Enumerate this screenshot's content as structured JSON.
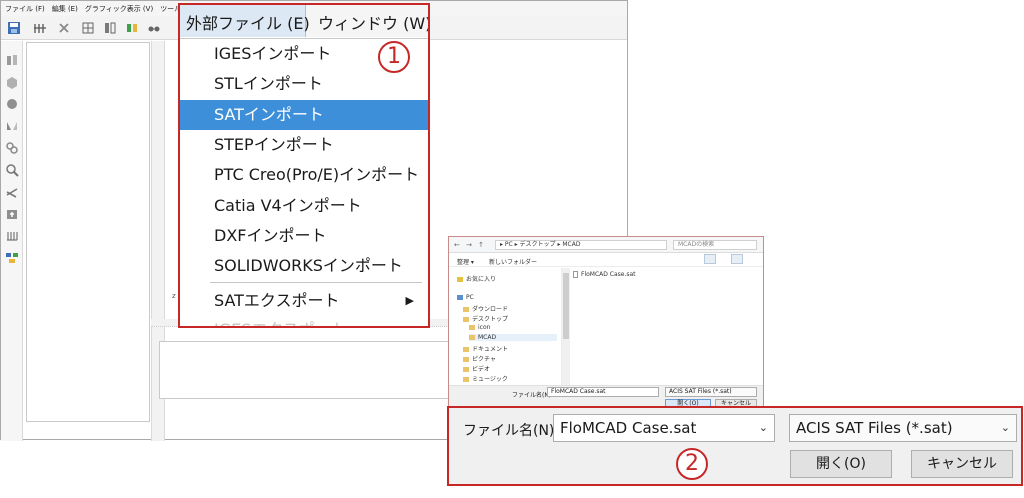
{
  "app": {
    "menubar": [
      "ファイル (F)",
      "編集 (E)",
      "グラフィック表示 (V)",
      "ツール"
    ],
    "stray_text": "z"
  },
  "dropdown": {
    "header_active": "外部ファイル (E)",
    "header_next": "ウィンドウ (W)",
    "items": [
      "IGESインポート",
      "STLインポート",
      "SATインポート",
      "STEPインポート",
      "PTC Creo(Pro/E)インポート",
      "Catia V4インポート",
      "DXFインポート",
      "SOLIDWORKSインポート",
      "SATエクスポート",
      "IGESエクスポート"
    ],
    "selected_index": 2,
    "submenu_arrow": "▶",
    "marker": "1"
  },
  "file_dialog": {
    "nav_arrows": "← → ↑",
    "address": "▸ PC ▸ デスクトップ ▸ MCAD",
    "search_placeholder": "MCADの検索",
    "organize": "整理 ▾",
    "new_folder": "新しいフォルダー",
    "nav": {
      "favorites": "お気に入り",
      "pc": "PC",
      "downloads": "ダウンロード",
      "desktop": "デスクトップ",
      "icon": "icon",
      "mcad": "MCAD",
      "documents": "ドキュメント",
      "pictures": "ピクチャ",
      "videos": "ビデオ",
      "music": "ミュージック"
    },
    "file_item": "FloMCAD Case.sat",
    "filename_label": "ファイル名(N):",
    "filename_value": "FloMCAD Case.sat",
    "filetype_value": "ACIS SAT Files (*.sat)",
    "open_button": "開く(O)",
    "cancel_button": "キャンセル"
  },
  "zoom_panel": {
    "filename_label": "ファイル名(N):",
    "filename_value": "FloMCAD Case.sat",
    "filetype_value": "ACIS SAT Files (*.sat)",
    "open_button": "開く(O)",
    "cancel_button": "キャンセル",
    "marker": "2",
    "dropdown_arrow": "⌄"
  },
  "colors": {
    "highlight_border": "#c62828",
    "menu_selection": "#3d8fd9"
  }
}
